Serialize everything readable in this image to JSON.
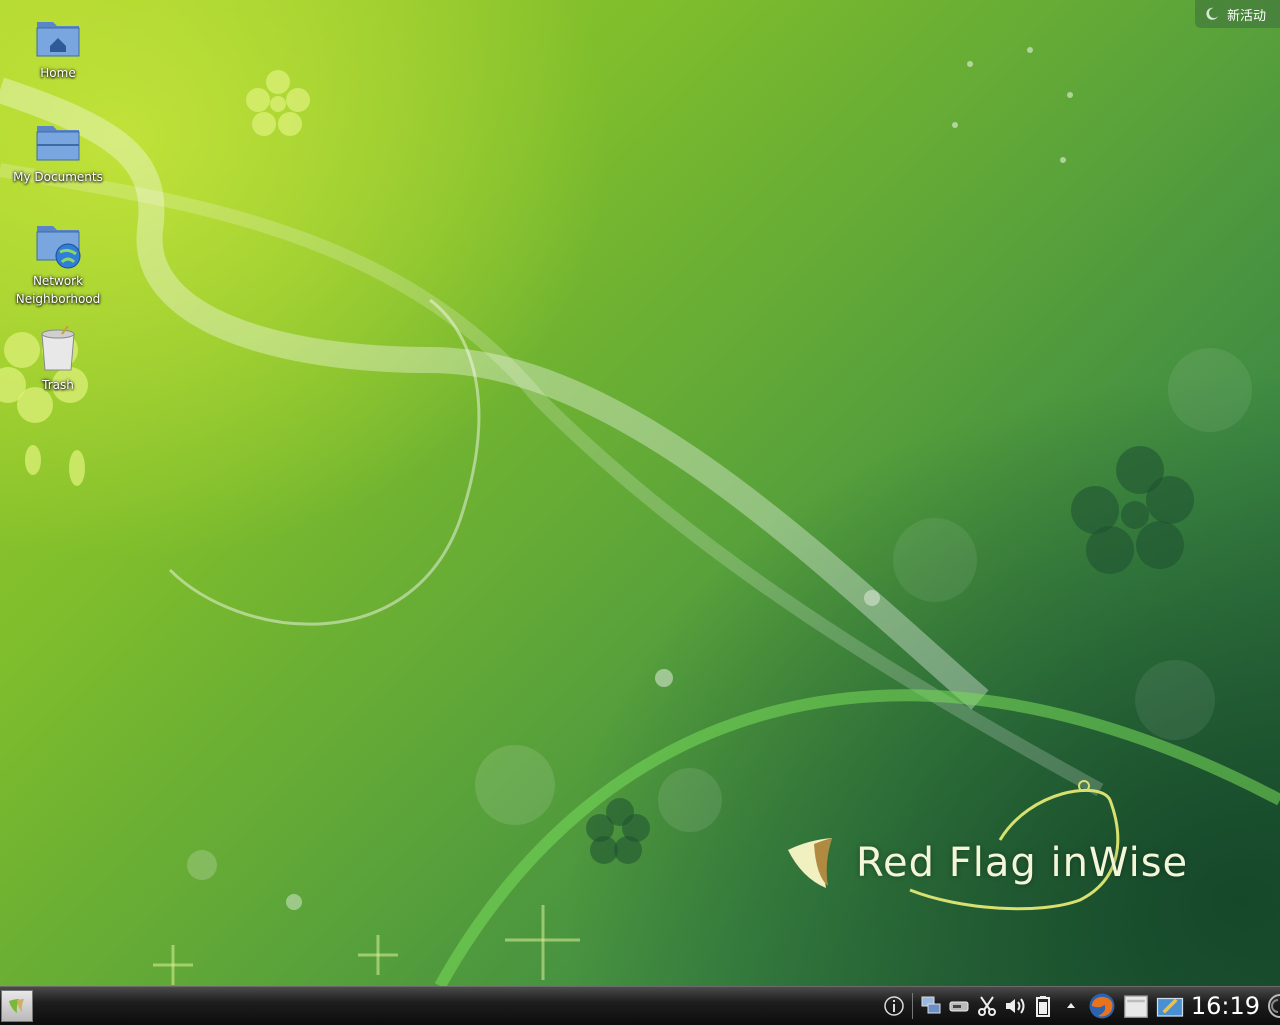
{
  "desktop": {
    "icons": [
      {
        "label": "Home",
        "icon": "home-folder-icon"
      },
      {
        "label": "My Documents",
        "icon": "folder-icon"
      },
      {
        "label": "Network\nNeighborhood",
        "icon": "network-folder-icon"
      },
      {
        "label": "Trash",
        "icon": "trash-icon"
      }
    ],
    "activity_button": {
      "label": "新活动",
      "icon": "activity-icon"
    },
    "brand": {
      "text": "Red Flag inWise",
      "icon": "red-flag-logo"
    }
  },
  "taskbar": {
    "start_icon": "start-menu-icon",
    "tray_icons": [
      "info-icon",
      "network-icon",
      "removable-device-icon",
      "klipper-scissors-icon",
      "volume-icon",
      "battery-icon",
      "expand-arrow-icon",
      "firefox-icon",
      "file-manager-icon",
      "notes-icon"
    ],
    "clock": "16:19",
    "corner_icon": "dashboard-toggle-icon"
  },
  "colors": {
    "wallpaper_light": "#a6d22a",
    "wallpaper_dark": "#245f3d",
    "taskbar": "#1e1e1e"
  }
}
